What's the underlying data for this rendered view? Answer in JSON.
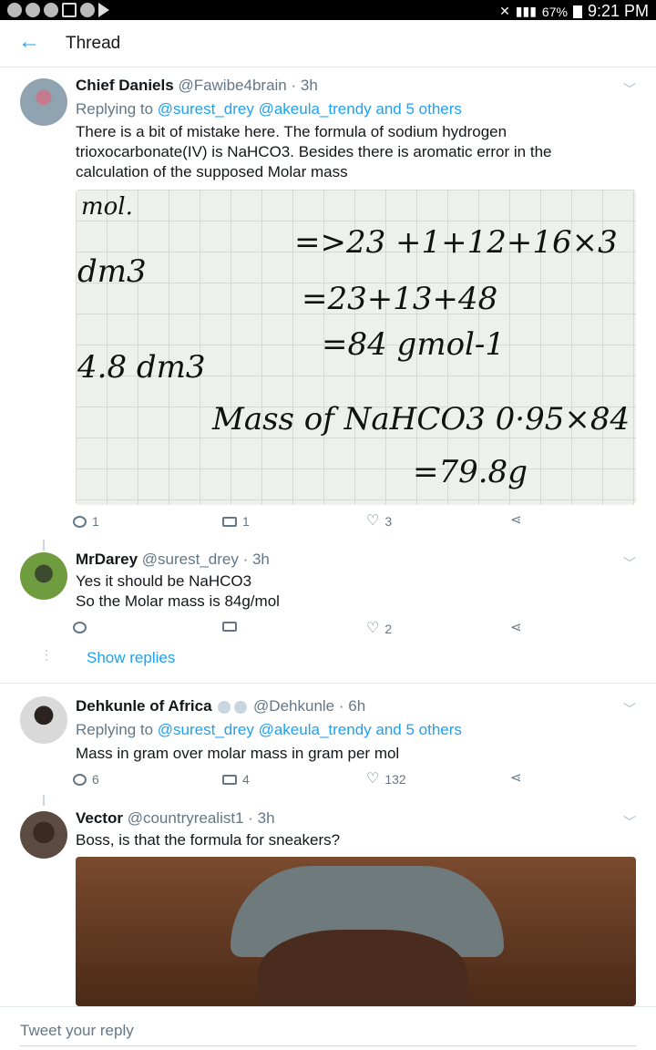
{
  "status_bar": {
    "battery": "67%",
    "time": "9:21 PM"
  },
  "header": {
    "title": "Thread"
  },
  "tweets": [
    {
      "name": "Chief Daniels",
      "handle": "@Fawibe4brain",
      "age": "· 3h",
      "reply_prefix": "Replying to",
      "reply_targets": "@surest_drey @akeula_trendy and 5 others",
      "text_lines": [
        "There is a bit of mistake here. The formula of sodium hydrogen",
        "trioxocarbonate(IV) is NaHCO3. Besides there is aromatic error in the",
        "calculation of the supposed Molar mass"
      ],
      "replies": "1",
      "retweets": "1",
      "likes": "3"
    },
    {
      "name": "MrDarey",
      "handle": "@surest_drey",
      "age": "· 3h",
      "text_lines": [
        "Yes it should be NaHCO3",
        "So the Molar mass is 84g/mol"
      ],
      "replies": "",
      "retweets": "",
      "likes": "2",
      "show_replies": "Show replies"
    },
    {
      "name": "Dehkunle of Africa",
      "handle": "@Dehkunle",
      "age": "· 6h",
      "reply_prefix": "Replying to",
      "reply_targets": "@surest_drey @akeula_trendy and 5 others",
      "text_lines": [
        "Mass in gram over molar mass in gram per mol"
      ],
      "replies": "6",
      "retweets": "4",
      "likes": "132"
    },
    {
      "name": "Vector",
      "handle": "@countryrealist1",
      "age": "· 3h",
      "text_lines": [
        "Boss, is that the formula for sneakers?"
      ]
    }
  ],
  "chalk_lines": [
    "mol.",
    "=>23   +1+12+16×3",
    "dm3",
    "=23+13+48",
    "=84 gmol-1",
    "4.8 dm3",
    "Mass of NaHCO3  0·95×84",
    "=79.8g"
  ],
  "reply_bar": {
    "placeholder": "Tweet your reply"
  },
  "colors": {
    "accent": "#1da1f2",
    "muted": "#657786"
  }
}
